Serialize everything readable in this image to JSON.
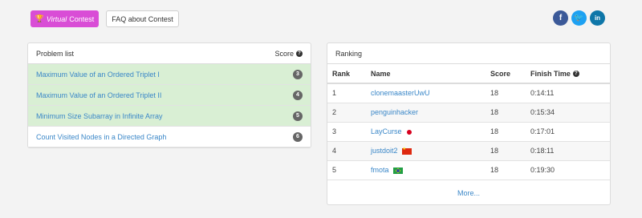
{
  "toolbar": {
    "virtual_label_italic": "Virtual",
    "virtual_label_rest": "Contest",
    "faq_label": "FAQ about Contest"
  },
  "social": {
    "facebook": "f",
    "twitter": "t",
    "linkedin": "in"
  },
  "problems": {
    "header": "Problem list",
    "score_header": "Score",
    "items": [
      {
        "title": "Maximum Value of an Ordered Triplet I",
        "score": "3",
        "solved": true
      },
      {
        "title": "Maximum Value of an Ordered Triplet II",
        "score": "4",
        "solved": true
      },
      {
        "title": "Minimum Size Subarray in Infinite Array",
        "score": "5",
        "solved": true
      },
      {
        "title": "Count Visited Nodes in a Directed Graph",
        "score": "6",
        "solved": false
      }
    ]
  },
  "ranking": {
    "header": "Ranking",
    "columns": [
      "Rank",
      "Name",
      "Score",
      "Finish Time"
    ],
    "rows": [
      {
        "rank": "1",
        "name": "clonemaasterUwU",
        "score": "18",
        "time": "0:14:11",
        "flag": ""
      },
      {
        "rank": "2",
        "name": "penguinhacker",
        "score": "18",
        "time": "0:15:34",
        "flag": ""
      },
      {
        "rank": "3",
        "name": "LayCurse",
        "score": "18",
        "time": "0:17:01",
        "flag": "jp"
      },
      {
        "rank": "4",
        "name": "justdoit2",
        "score": "18",
        "time": "0:18:11",
        "flag": "cn"
      },
      {
        "rank": "5",
        "name": "fmota",
        "score": "18",
        "time": "0:19:30",
        "flag": "br"
      }
    ],
    "more_label": "More..."
  },
  "colors": {
    "virtual_button": "#d94dd6",
    "solved_row": "#d9efd4",
    "link": "#3a87c8"
  }
}
